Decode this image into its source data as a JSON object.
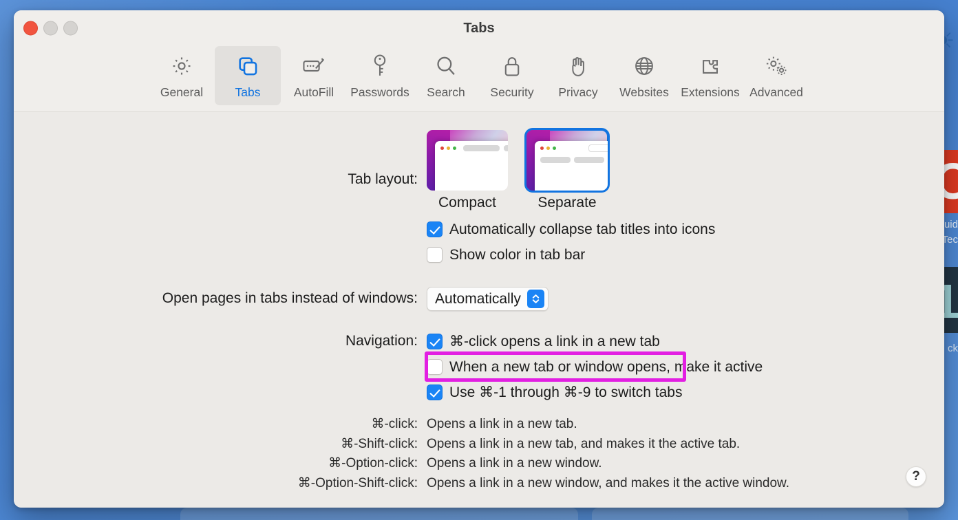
{
  "window": {
    "title": "Tabs",
    "traffic_lights": [
      {
        "name": "close",
        "color": "#f1543f"
      },
      {
        "name": "minimize",
        "color": "#d5d3d0"
      },
      {
        "name": "zoom",
        "color": "#d5d3d0"
      }
    ]
  },
  "toolbar": {
    "items": [
      {
        "label": "General",
        "icon": "gear-icon",
        "selected": false
      },
      {
        "label": "Tabs",
        "icon": "tabs-icon",
        "selected": true
      },
      {
        "label": "AutoFill",
        "icon": "autofill-icon",
        "selected": false
      },
      {
        "label": "Passwords",
        "icon": "key-icon",
        "selected": false
      },
      {
        "label": "Search",
        "icon": "search-icon",
        "selected": false
      },
      {
        "label": "Security",
        "icon": "lock-icon",
        "selected": false
      },
      {
        "label": "Privacy",
        "icon": "hand-icon",
        "selected": false
      },
      {
        "label": "Websites",
        "icon": "globe-icon",
        "selected": false
      },
      {
        "label": "Extensions",
        "icon": "puzzle-icon",
        "selected": false
      },
      {
        "label": "Advanced",
        "icon": "gears-icon",
        "selected": false
      }
    ]
  },
  "settings": {
    "tab_layout": {
      "label": "Tab layout:",
      "options": [
        {
          "caption": "Compact",
          "selected": false
        },
        {
          "caption": "Separate",
          "selected": true
        }
      ]
    },
    "layout_checkboxes": [
      {
        "label": "Automatically collapse tab titles into icons",
        "checked": true
      },
      {
        "label": "Show color in tab bar",
        "checked": false,
        "highlighted": true
      }
    ],
    "open_pages": {
      "label": "Open pages in tabs instead of windows:",
      "value": "Automatically"
    },
    "navigation": {
      "label": "Navigation:",
      "checkboxes": [
        {
          "label": "⌘-click opens a link in a new tab",
          "checked": true
        },
        {
          "label": "When a new tab or window opens, make it active",
          "checked": false
        },
        {
          "label": "Use ⌘-1 through ⌘-9 to switch tabs",
          "checked": true
        }
      ]
    },
    "shortcuts": [
      {
        "key": "⌘-click:",
        "description": "Opens a link in a new tab."
      },
      {
        "key": "⌘-Shift-click:",
        "description": "Opens a link in a new tab, and makes it the active tab."
      },
      {
        "key": "⌘-Option-click:",
        "description": "Opens a link in a new window."
      },
      {
        "key": "⌘-Option-Shift-click:",
        "description": "Opens a link in a new window, and makes it the active window."
      }
    ]
  },
  "help_button": {
    "label": "?"
  },
  "annotation": {
    "color": "#e21fe2",
    "target": "Show color in tab bar"
  },
  "background": {
    "globe_glyph": "◔",
    "red_card_text": "O",
    "caption_1": "uid\nTec",
    "dark_card_text": "1",
    "caption_2": "ck"
  }
}
